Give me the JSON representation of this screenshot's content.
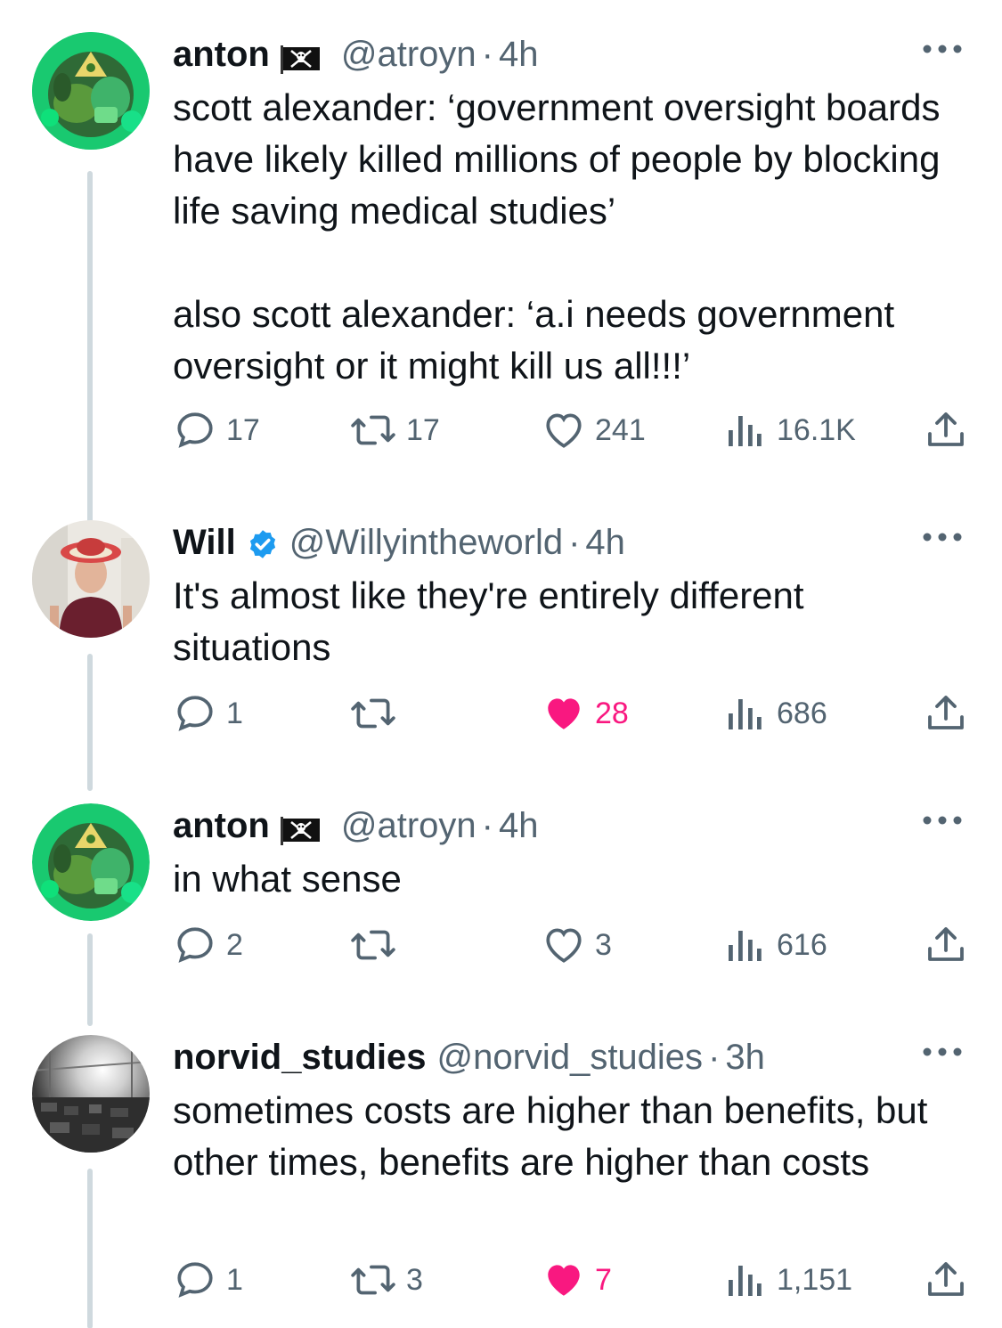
{
  "tweets": [
    {
      "name": "anton",
      "handle": "@atroyn",
      "separator": "·",
      "time": "4h",
      "text": "scott alexander: ‘government oversight boards have likely killed millions of people by blocking life saving medical studies’\n\nalso scott alexander: ‘a.i needs government oversight or it might kill us all!!!’",
      "badge": "pirate-flag-icon",
      "replies": "17",
      "reposts": "17",
      "likes": "241",
      "liked": false,
      "views": "16.1K"
    },
    {
      "name": "Will",
      "handle": "@Willyintheworld",
      "separator": "·",
      "time": "4h",
      "text": "It's almost like they're entirely different situations",
      "badge": "verified-badge-icon",
      "replies": "1",
      "reposts": "",
      "likes": "28",
      "liked": true,
      "views": "686"
    },
    {
      "name": "anton",
      "handle": "@atroyn",
      "separator": "·",
      "time": "4h",
      "text": "in what sense",
      "badge": "pirate-flag-icon",
      "replies": "2",
      "reposts": "",
      "likes": "3",
      "liked": false,
      "views": "616"
    },
    {
      "name": "norvid_studies",
      "handle": "@norvid_studies",
      "separator": "·",
      "time": "3h",
      "text": "sometimes costs are higher than benefits, but other times, benefits are higher than costs",
      "badge": "",
      "replies": "1",
      "reposts": "3",
      "likes": "7",
      "liked": true,
      "views": "1,151"
    }
  ],
  "colors": {
    "text": "#0f1419",
    "secondary": "#536471",
    "like_pink": "#f91880",
    "verified_blue": "#1d9bf0",
    "thread_line": "#cfd9de"
  }
}
